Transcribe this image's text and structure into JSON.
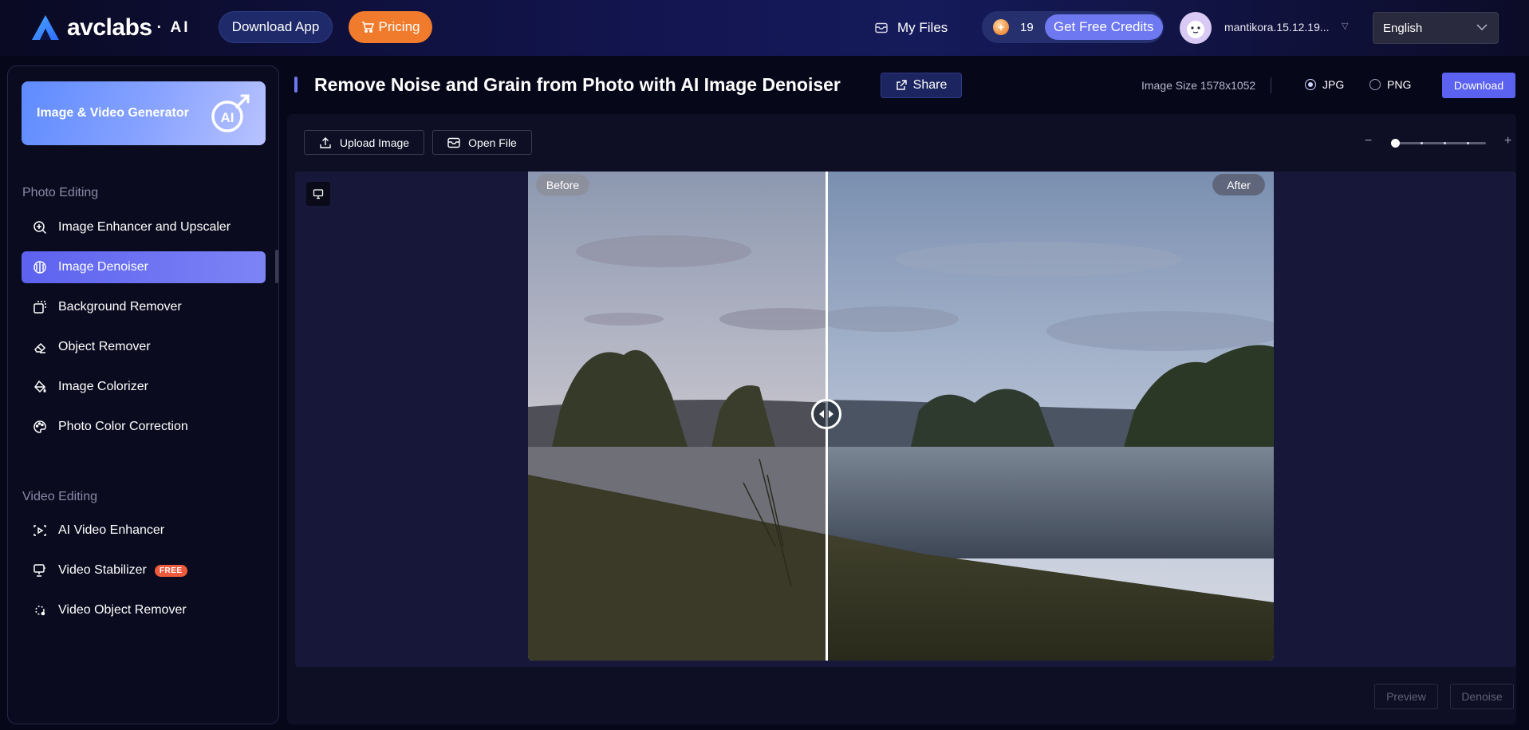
{
  "header": {
    "logo_text": "avclabs",
    "logo_suffix": "AI",
    "download_app_label": "Download App",
    "pricing_label": "Pricing",
    "my_files_label": "My Files",
    "credits_count": "19",
    "free_credits_label": "Get Free Credits",
    "username": "mantikora.15.12.19...",
    "language": "English"
  },
  "sidebar": {
    "generator_label": "Image & Video Generator",
    "photo_section_title": "Photo Editing",
    "photo_items": [
      {
        "label": "Image Enhancer and Upscaler",
        "icon": "magnify-plus-icon"
      },
      {
        "label": "Image Denoiser",
        "icon": "denoise-icon",
        "active": true
      },
      {
        "label": "Background Remover",
        "icon": "background-remove-icon"
      },
      {
        "label": "Object Remover",
        "icon": "eraser-icon"
      },
      {
        "label": "Image Colorizer",
        "icon": "paint-bucket-icon"
      },
      {
        "label": "Photo Color Correction",
        "icon": "palette-icon"
      }
    ],
    "video_section_title": "Video Editing",
    "video_items": [
      {
        "label": "AI Video Enhancer",
        "icon": "video-enhance-icon"
      },
      {
        "label": "Video Stabilizer",
        "icon": "stabilizer-icon",
        "badge": "FREE"
      },
      {
        "label": "Video Object Remover",
        "icon": "video-object-remove-icon"
      }
    ]
  },
  "main": {
    "title": "Remove Noise and Grain from Photo with AI Image Denoiser",
    "share_label": "Share",
    "image_size": "Image Size 1578x1052",
    "format_jpg": "JPG",
    "format_png": "PNG",
    "selected_format": "JPG",
    "download_label": "Download",
    "upload_label": "Upload Image",
    "open_file_label": "Open File",
    "before_label": "Before",
    "after_label": "After",
    "preview_label": "Preview",
    "denoise_label": "Denoise",
    "zoom_level": 0.03,
    "split_position": 0.4
  },
  "colors": {
    "accent": "#5a62ef",
    "pricing": "#f07b2c",
    "background": "#07071a",
    "free_badge": "#ec5b3d"
  }
}
